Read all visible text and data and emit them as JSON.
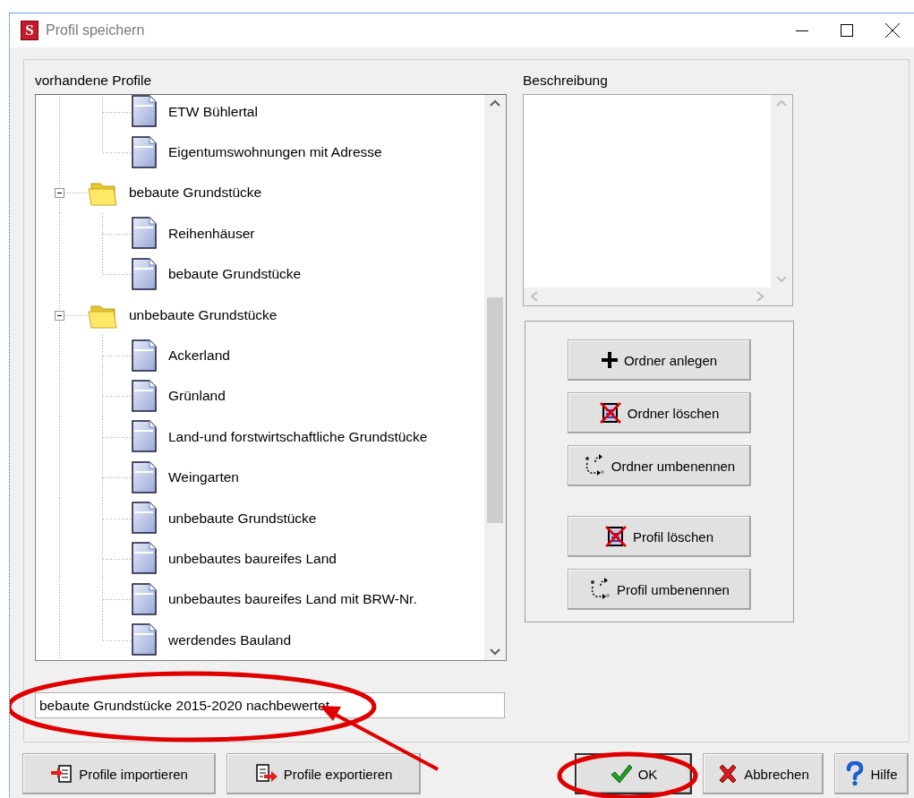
{
  "window": {
    "icon_letter": "S",
    "title": "Profil speichern"
  },
  "tree": {
    "label": "vorhandene Profile",
    "nodes": [
      {
        "children": [
          {
            "kind": "profile",
            "label": "ETW Bühlertal"
          },
          {
            "kind": "profile",
            "label": "Eigentumswohnungen mit Adresse"
          }
        ]
      },
      {
        "kind": "folder",
        "label": "bebaute Grundstücke",
        "expanded": true,
        "children": [
          {
            "kind": "profile",
            "label": "Reihenhäuser"
          },
          {
            "kind": "profile",
            "label": "bebaute Grundstücke"
          }
        ]
      },
      {
        "kind": "folder",
        "label": "unbebaute Grundstücke",
        "expanded": true,
        "children": [
          {
            "kind": "profile",
            "label": "Ackerland"
          },
          {
            "kind": "profile",
            "label": "Grünland"
          },
          {
            "kind": "profile",
            "label": "Land-und forstwirtschaftliche Grundstücke"
          },
          {
            "kind": "profile",
            "label": "Weingarten"
          },
          {
            "kind": "profile",
            "label": "unbebaute Grundstücke"
          },
          {
            "kind": "profile",
            "label": "unbebautes baureifes Land"
          },
          {
            "kind": "profile",
            "label": "unbebautes baureifes Land mit BRW-Nr."
          },
          {
            "kind": "profile",
            "label": "werdendes Bauland"
          }
        ]
      }
    ]
  },
  "description": {
    "label": "Beschreibung"
  },
  "folder_buttons": [
    {
      "kind": "add",
      "label": "Ordner anlegen"
    },
    {
      "kind": "delete",
      "label": "Ordner löschen"
    },
    {
      "kind": "rename",
      "label": "Ordner umbenennen"
    }
  ],
  "profile_buttons": [
    {
      "kind": "delete",
      "label": "Profil löschen"
    },
    {
      "kind": "rename",
      "label": "Profil umbenennen"
    }
  ],
  "name_field": {
    "value": "bebaute Grundstücke 2015-2020 nachbewertet"
  },
  "bottom_buttons": [
    {
      "kind": "import",
      "label": "Profile importieren",
      "default": false
    },
    {
      "kind": "export",
      "label": "Profile exportieren",
      "default": false
    },
    {
      "kind": "ok",
      "label": "OK",
      "default": true
    },
    {
      "kind": "cancel",
      "label": "Abbrechen",
      "default": false
    },
    {
      "kind": "help",
      "label": "Hilfe",
      "default": false
    }
  ],
  "annotations": [
    {
      "kind": "ellipse"
    },
    {
      "kind": "arrow"
    },
    {
      "kind": "ellipse"
    }
  ]
}
